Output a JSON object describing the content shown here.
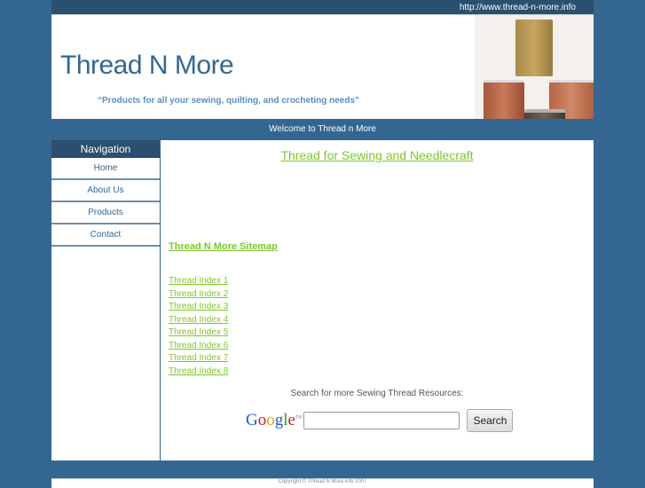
{
  "topbar": {
    "url": "http://www.thread-n-more.info"
  },
  "header": {
    "title": "Thread N More",
    "tagline": "“Products for all your sewing, quilting, and crocheting needs”",
    "image_alt": "thread spools"
  },
  "welcome": "Welcome to Thread n More",
  "navigation": {
    "heading": "Navigation",
    "items": [
      {
        "label": "Home"
      },
      {
        "label": "About Us"
      },
      {
        "label": "Products"
      },
      {
        "label": "Contact"
      }
    ]
  },
  "main": {
    "title": "Thread for Sewing and Needlecraft",
    "sitemap": "Thread N More Sitemap",
    "index_links": [
      "Thread Index 1",
      "Thread Index 2",
      "Thread Index 3",
      "Thread Index 4",
      "Thread Index 5",
      "Thread Index 6",
      "Thread Index 7",
      "Thread Index 8"
    ],
    "search": {
      "label": "Search for more Sewing Thread Resources:",
      "logo": {
        "G": "G",
        "o1": "o",
        "o2": "o",
        "g": "g",
        "l": "l",
        "e": "e",
        "tm": "TM"
      },
      "input_value": "",
      "button": "Search"
    }
  },
  "footer": {
    "text": "Copyright © Thread N More.info 2007"
  },
  "colors": {
    "page_bg": "#336791",
    "bar_dark": "#2b4f6e",
    "title": "#336791",
    "tagline": "#5b8ec0",
    "link_green": "#7dc828"
  }
}
